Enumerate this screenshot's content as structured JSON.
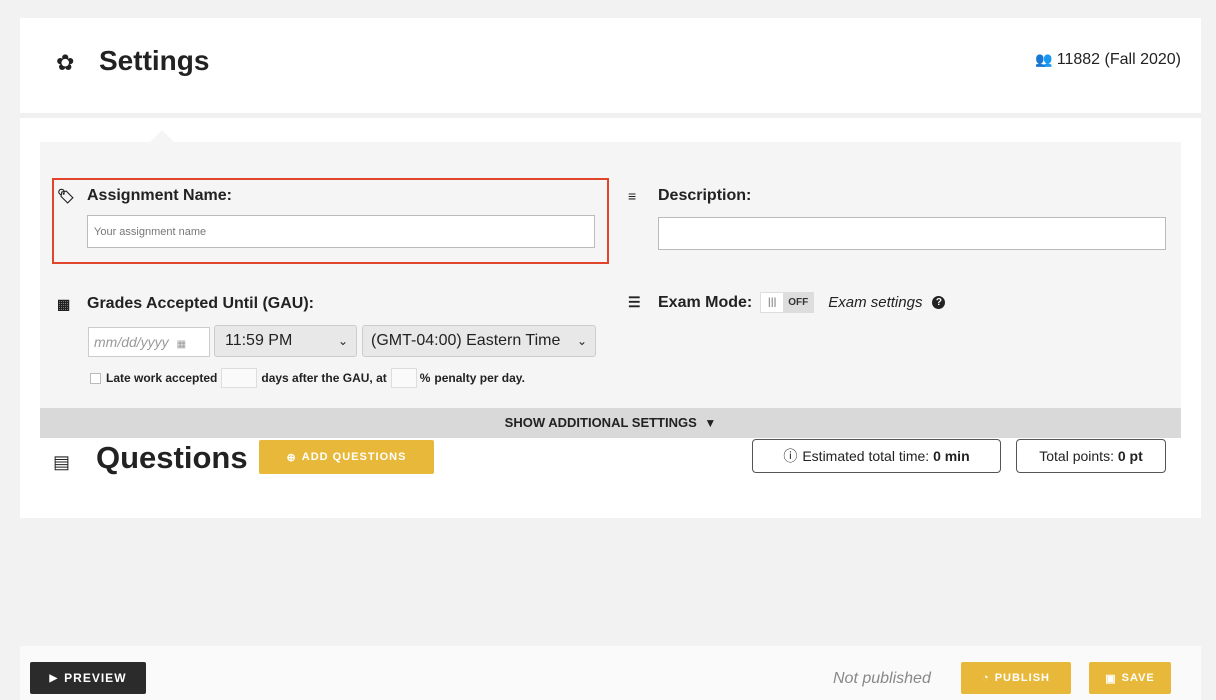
{
  "header": {
    "title": "Settings",
    "course": "11882 (Fall 2020)"
  },
  "form": {
    "assignment_name_label": "Assignment Name:",
    "assignment_name_placeholder": "Your assignment name",
    "description_label": "Description:",
    "gau_label": "Grades Accepted Until (GAU):",
    "date_placeholder": "mm/dd/yyyy",
    "time_value": "11:59 PM",
    "timezone_value": "(GMT-04:00) Eastern Time",
    "late_work_label": "Late work accepted",
    "late_days_text": "days after the GAU, at",
    "late_pct_symbol": "%",
    "late_penalty_text": "penalty per day.",
    "exam_mode_label": "Exam Mode:",
    "exam_toggle_state": "OFF",
    "exam_settings_link": "Exam settings"
  },
  "show_additional": "SHOW ADDITIONAL SETTINGS",
  "questions": {
    "title": "Questions",
    "add_button": "ADD QUESTIONS",
    "est_time_label": "Estimated total time:",
    "est_time_value": "0 min",
    "total_points_label": "Total points:",
    "total_points_value": "0 pt"
  },
  "footer": {
    "preview": "PREVIEW",
    "status": "Not published",
    "publish": "PUBLISH",
    "save": "SAVE"
  },
  "colors": {
    "accent_yellow": "#e8b83a",
    "highlight_red": "#e0442a",
    "dark_button": "#2b2b2b"
  },
  "icons": [
    "gear-icon",
    "users-icon",
    "tag-icon",
    "description-icon",
    "calendar-icon",
    "exam-icon",
    "help-icon",
    "caret-down-icon",
    "questions-list-icon",
    "plus-circle-icon",
    "info-icon",
    "play-icon",
    "publish-icon",
    "save-icon"
  ]
}
